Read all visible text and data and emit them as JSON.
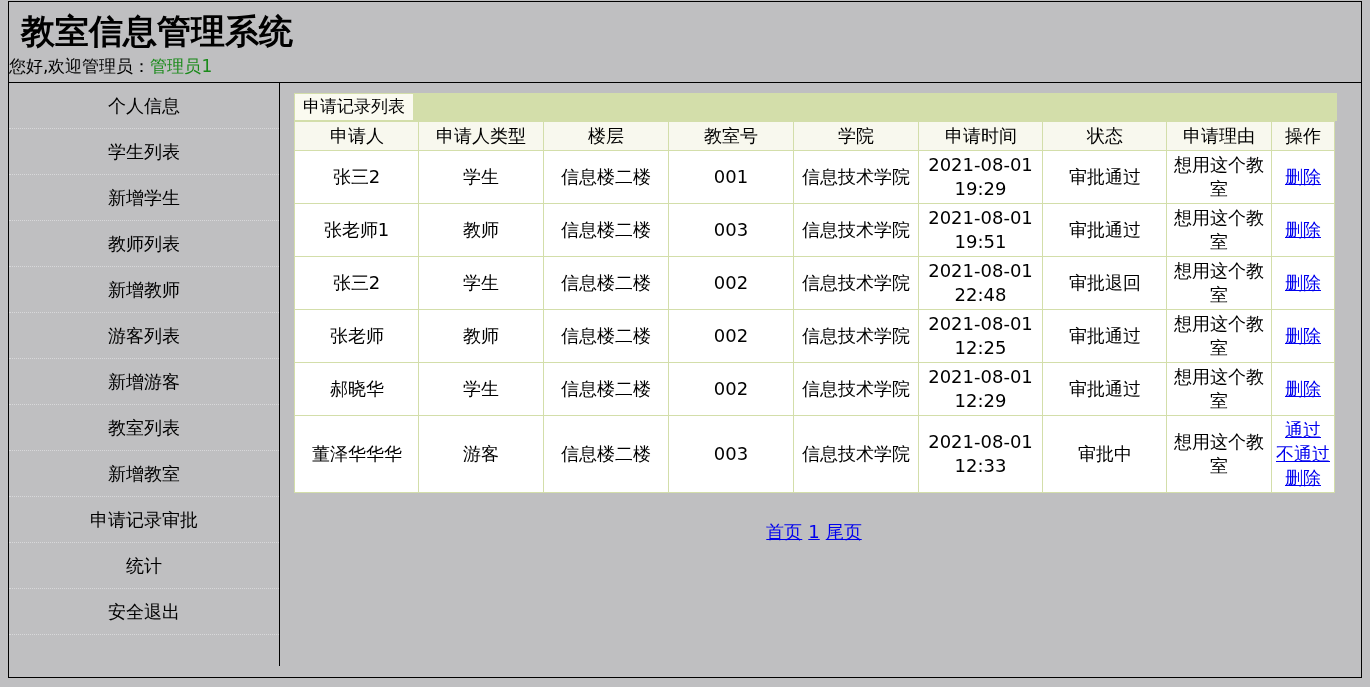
{
  "header": {
    "title": "教室信息管理系统",
    "greeting": "您好,欢迎管理员：",
    "user": "管理员1"
  },
  "sidebar": {
    "items": [
      "个人信息",
      "学生列表",
      "新增学生",
      "教师列表",
      "新增教师",
      "游客列表",
      "新增游客",
      "教室列表",
      "新增教室",
      "申请记录审批",
      "统计",
      "安全退出"
    ]
  },
  "panel": {
    "tab": "申请记录列表",
    "columns": [
      "申请人",
      "申请人类型",
      "楼层",
      "教室号",
      "学院",
      "申请时间",
      "状态",
      "申请理由",
      "操作"
    ],
    "rows": [
      {
        "cells": [
          "张三2",
          "学生",
          "信息楼二楼",
          "001",
          "信息技术学院",
          "2021-08-01 19:29",
          "审批通过",
          "想用这个教室"
        ],
        "actions": [
          "删除"
        ]
      },
      {
        "cells": [
          "张老师1",
          "教师",
          "信息楼二楼",
          "003",
          "信息技术学院",
          "2021-08-01 19:51",
          "审批通过",
          "想用这个教室"
        ],
        "actions": [
          "删除"
        ]
      },
      {
        "cells": [
          "张三2",
          "学生",
          "信息楼二楼",
          "002",
          "信息技术学院",
          "2021-08-01 22:48",
          "审批退回",
          "想用这个教室"
        ],
        "actions": [
          "删除"
        ]
      },
      {
        "cells": [
          "张老师",
          "教师",
          "信息楼二楼",
          "002",
          "信息技术学院",
          "2021-08-01 12:25",
          "审批通过",
          "想用这个教室"
        ],
        "actions": [
          "删除"
        ]
      },
      {
        "cells": [
          "郝晓华",
          "学生",
          "信息楼二楼",
          "002",
          "信息技术学院",
          "2021-08-01 12:29",
          "审批通过",
          "想用这个教室"
        ],
        "actions": [
          "删除"
        ]
      },
      {
        "cells": [
          "董泽华华华",
          "游客",
          "信息楼二楼",
          "003",
          "信息技术学院",
          "2021-08-01 12:33",
          "审批中",
          "想用这个教室"
        ],
        "actions": [
          "通过",
          "不通过",
          "删除"
        ]
      }
    ]
  },
  "pagination": [
    "首页",
    "1",
    "尾页"
  ]
}
